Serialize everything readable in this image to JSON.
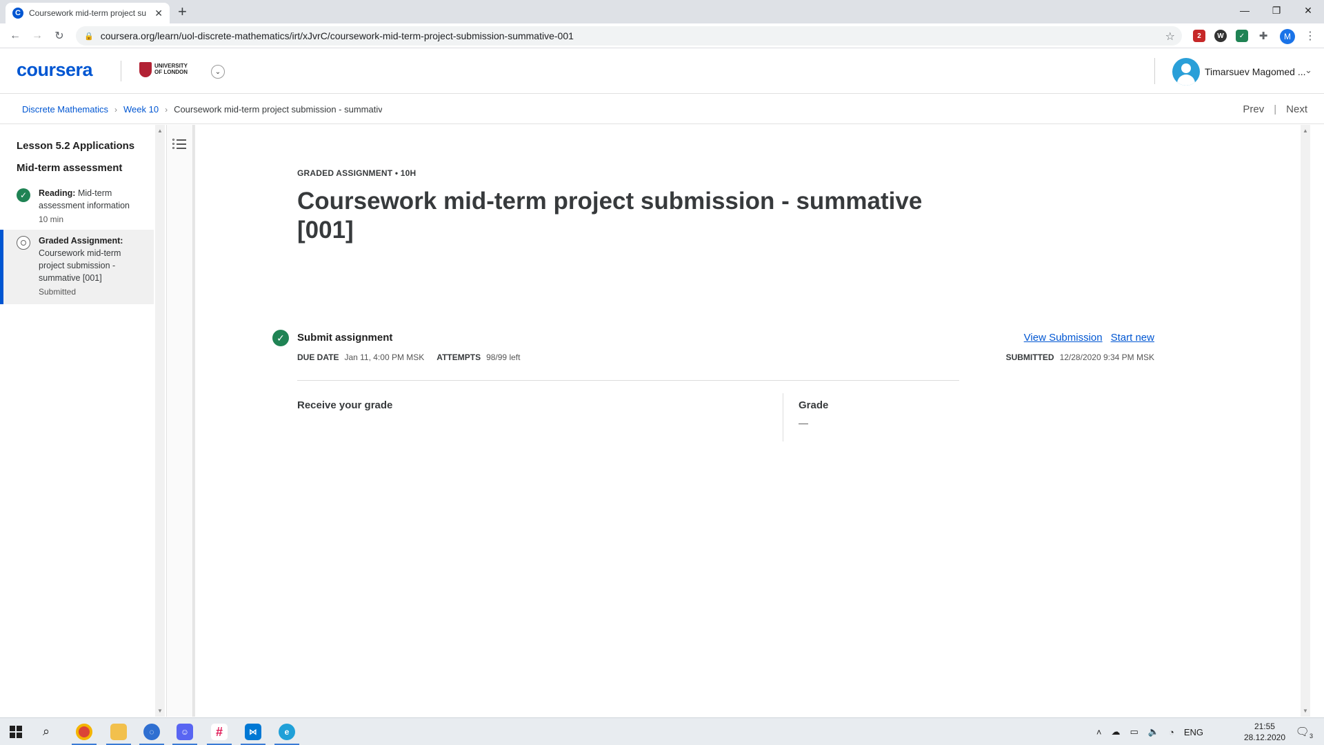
{
  "browser": {
    "tab_title": "Coursework mid-term project su",
    "tab_favicon": "C",
    "url": "coursera.org/learn/uol-discrete-mathematics/irt/xJvrC/coursework-mid-term-project-submission-summative-001",
    "profile_initial": "M",
    "extension_badge": "2"
  },
  "header": {
    "logo": "coursera",
    "partner_line1": "UNIVERSITY",
    "partner_line2": "OF LONDON",
    "user_name": "Timarsuev Magomed ..."
  },
  "breadcrumb": {
    "items": [
      "Discrete Mathematics",
      "Week 10"
    ],
    "current": "Coursework mid-term project submission - summative",
    "prev": "Prev",
    "next": "Next"
  },
  "sidebar": {
    "lesson_title": "Lesson 5.2 Applications",
    "section_title": "Mid-term assessment",
    "items": [
      {
        "type_label": "Reading:",
        "title": "Mid-term assessment information",
        "meta": "10 min"
      },
      {
        "type_label": "Graded Assignment:",
        "title": "Coursework mid-term project submission - summative [001]",
        "meta": "Submitted"
      }
    ]
  },
  "main": {
    "kicker": "GRADED ASSIGNMENT • 10H",
    "title": "Coursework mid-term project submission - summative [001]",
    "step_title": "Submit assignment",
    "view_submission": "View Submission",
    "start_new": "Start new",
    "due_label": "DUE DATE",
    "due_value": "Jan 11, 4:00 PM MSK",
    "attempts_label": "ATTEMPTS",
    "attempts_value": "98/99 left",
    "submitted_label": "SUBMITTED",
    "submitted_value": "12/28/2020 9:34 PM MSK",
    "receive_title": "Receive your grade",
    "grade_label": "Grade",
    "grade_value": "—"
  },
  "taskbar": {
    "language": "ENG",
    "time": "21:55",
    "date": "28.12.2020",
    "notifications": "3"
  }
}
